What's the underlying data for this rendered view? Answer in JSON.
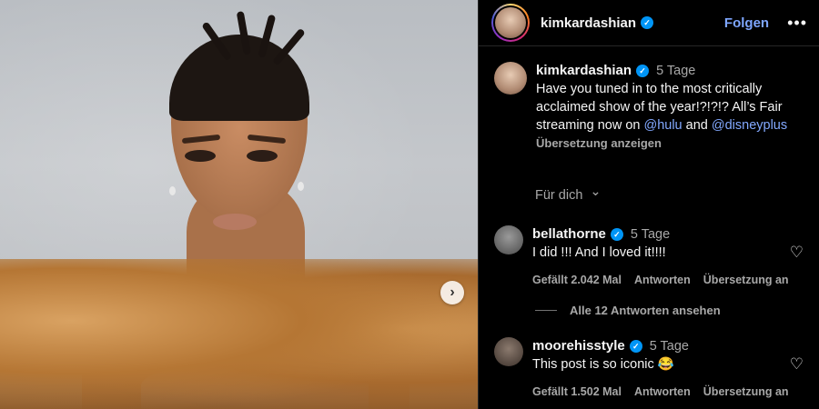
{
  "post": {
    "username": "kimkardashian",
    "follow_label": "Folgen",
    "more_label": "•••",
    "next_label": "›"
  },
  "caption": {
    "username": "kimkardashian",
    "time": "5 Tage",
    "text_before": "Have you tuned in to the most critically acclaimed show of the year!?!?!? All’s Fair streaming now on ",
    "mention1": "@hulu",
    "text_middle": " and ",
    "mention2": "@disneyplus",
    "translate": "Übersetzung anzeigen"
  },
  "for_you": "Für dich",
  "comments": [
    {
      "username": "bellathorne",
      "time": "5 Tage",
      "text": "I did !!! And I loved it!!!!",
      "likes": "Gefällt 2.042 Mal",
      "reply": "Antworten",
      "translate": "Übersetzung an"
    },
    {
      "username": "moorehisstyle",
      "time": "5 Tage",
      "text": "This post is so iconic 😂",
      "likes": "Gefällt 1.502 Mal",
      "reply": "Antworten",
      "translate": "Übersetzung an"
    }
  ],
  "view_replies": "Alle 12 Antworten ansehen",
  "icons": {
    "verified": "✓",
    "heart": "♡",
    "chevron": "⌄"
  }
}
